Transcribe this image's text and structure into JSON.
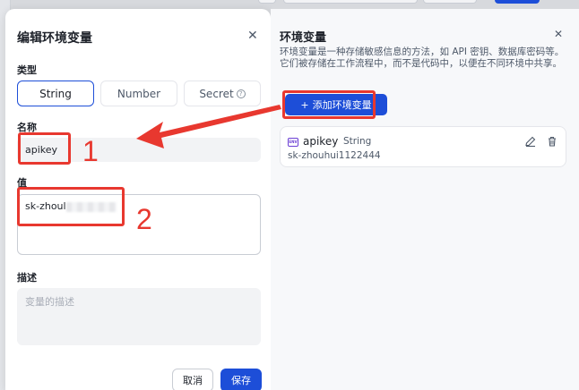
{
  "edit_modal": {
    "title": "编辑环境变量",
    "close_icon": "close-icon",
    "type_label": "类型",
    "types": [
      {
        "label": "String",
        "active": true
      },
      {
        "label": "Number",
        "active": false
      },
      {
        "label": "Secret",
        "active": false,
        "icon": "help-icon"
      }
    ],
    "name_label": "名称",
    "name_value": "apikey",
    "value_label": "值",
    "value_text": "sk-zhoul",
    "desc_label": "描述",
    "desc_placeholder": "变量的描述",
    "cancel_label": "取消",
    "save_label": "保存"
  },
  "env_drawer": {
    "title": "环境变量",
    "close_icon": "close-icon",
    "description": "环境变量是一种存储敏感信息的方法，如 API 密钥、数据库密码等。它们被存储在工作流程中，而不是代码中，以便在不同环境中共享。",
    "add_button": "添加环境变量",
    "variables": [
      {
        "name": "apikey",
        "type": "String",
        "value": "sk-zhouhui1122444",
        "icon": "env-icon"
      }
    ]
  },
  "annotations": {
    "label_1": "1",
    "label_2": "2",
    "accent": "#e8382f"
  },
  "colors": {
    "primary": "#1d4ed8",
    "annotation": "#e8382f",
    "env_icon": "#6b3fd4"
  }
}
